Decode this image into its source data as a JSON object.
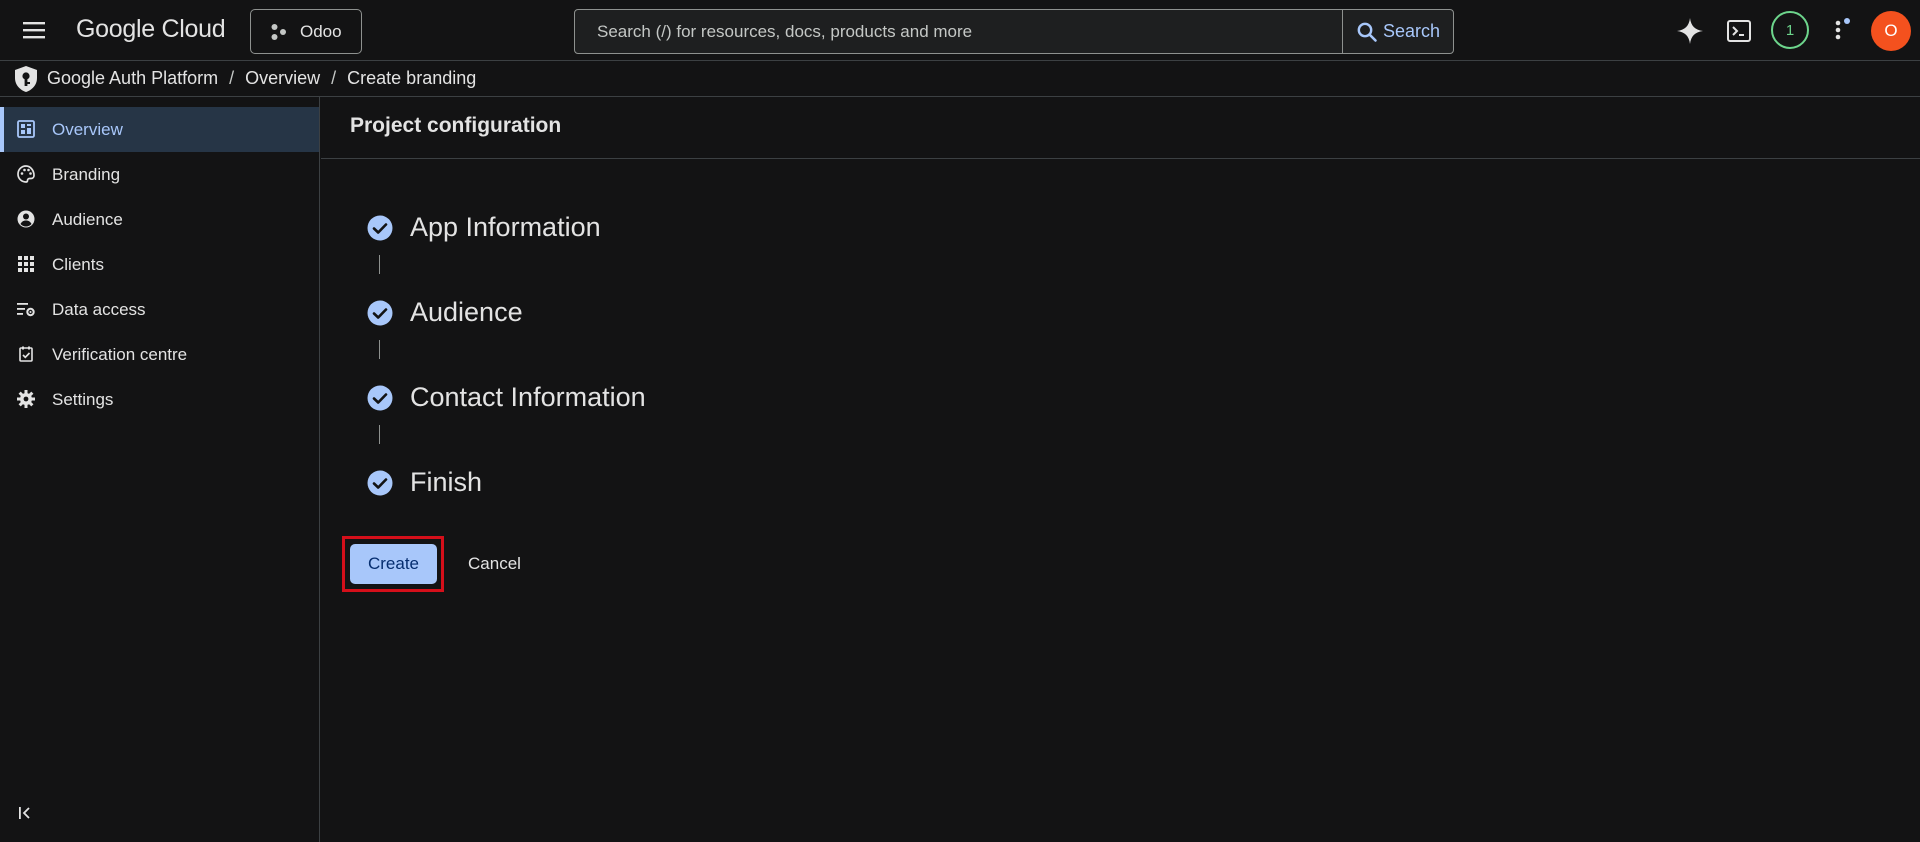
{
  "header": {
    "logo_google": "Google",
    "logo_cloud": "Cloud",
    "project_name": "Odoo",
    "search_placeholder": "Search (/) for resources, docs, products and more",
    "search_button": "Search",
    "notification_count": "1",
    "avatar_initial": "O"
  },
  "breadcrumb": {
    "items": [
      "Google Auth Platform",
      "Overview",
      "Create branding"
    ],
    "separator": "/"
  },
  "sidebar": {
    "items": [
      {
        "label": "Overview",
        "icon": "dashboard-icon",
        "active": true
      },
      {
        "label": "Branding",
        "icon": "palette-icon",
        "active": false
      },
      {
        "label": "Audience",
        "icon": "account-circle-icon",
        "active": false
      },
      {
        "label": "Clients",
        "icon": "apps-grid-icon",
        "active": false
      },
      {
        "label": "Data access",
        "icon": "data-access-icon",
        "active": false
      },
      {
        "label": "Verification centre",
        "icon": "verified-checkbox-icon",
        "active": false
      },
      {
        "label": "Settings",
        "icon": "gear-icon",
        "active": false
      }
    ]
  },
  "main": {
    "title": "Project configuration",
    "steps": [
      {
        "label": "App Information",
        "complete": true
      },
      {
        "label": "Audience",
        "complete": true
      },
      {
        "label": "Contact Information",
        "complete": true
      },
      {
        "label": "Finish",
        "complete": true
      }
    ],
    "create_label": "Create",
    "cancel_label": "Cancel"
  },
  "colors": {
    "background": "#131314",
    "accent": "#a8c7fa",
    "active_nav_bg": "#263546",
    "focus_outline": "#d50f1a",
    "avatar_bg": "#f4511e",
    "badge_green": "#6dd58c"
  }
}
